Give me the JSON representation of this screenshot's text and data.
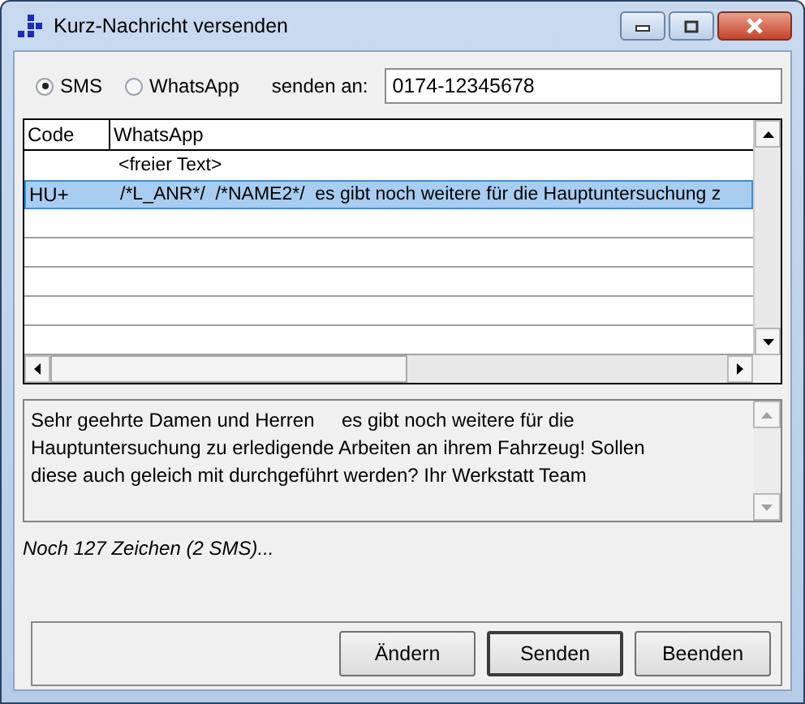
{
  "window": {
    "title": "Kurz-Nachricht versenden"
  },
  "channel_options": [
    {
      "label": "SMS",
      "selected": true
    },
    {
      "label": "WhatsApp",
      "selected": false
    }
  ],
  "recipient": {
    "label": "senden an:",
    "value": "0174-12345678"
  },
  "table": {
    "columns": [
      "Code",
      "WhatsApp"
    ],
    "rows": [
      {
        "text": "<freier Text>",
        "selected": false
      },
      {
        "code": "HU+",
        "text": "/*L_ANR*/  /*NAME2*/  es gibt noch weitere für die Hauptuntersuchung z",
        "selected": true
      }
    ]
  },
  "message": {
    "value": "Sehr geehrte Damen und Herren     es gibt noch weitere für die Hauptuntersuchung zu erledigende Arbeiten an ihrem Fahrzeug! Sollen diese auch geleich mit durchgeführt werden? Ihr Werkstatt Team"
  },
  "status": "Noch 127 Zeichen (2 SMS)...",
  "buttons": [
    {
      "label": "Ändern"
    },
    {
      "label": "Senden"
    },
    {
      "label": "Beenden"
    }
  ]
}
